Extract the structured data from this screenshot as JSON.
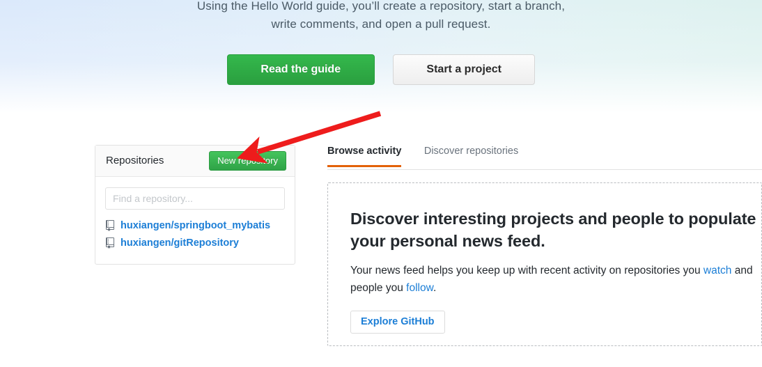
{
  "hero": {
    "line_1": "Using the Hello World guide, you’ll create a repository, start a branch,",
    "line_2": "write comments, and open a pull request.",
    "read_guide_label": "Read the guide",
    "start_project_label": "Start a project",
    "read_guide_color": "#2a9f3f",
    "background_left_color": "#dbe9fb",
    "background_right_color": "#ddf1ef"
  },
  "repositories": {
    "title": "Repositories",
    "new_repository_label": "New repository",
    "new_repository_color": "#2fa347",
    "search_placeholder": "Find a repository...",
    "search_value": "",
    "items": [
      {
        "name": "huxiangen/springboot_mybatis",
        "icon": "repo-icon"
      },
      {
        "name": "huxiangen/gitRepository",
        "icon": "repo-icon"
      }
    ]
  },
  "activity": {
    "tabs": [
      {
        "label": "Browse activity",
        "active": true
      },
      {
        "label": "Discover repositories",
        "active": false
      }
    ],
    "active_tab_underline_color": "#e36209",
    "callout": {
      "heading": "Discover interesting projects and people to populate your personal news feed.",
      "description_part_1": "Your news feed helps you keep up with recent activity on repositories you ",
      "description_link_1": "watch",
      "description_part_2": " and people you ",
      "description_link_2": "follow",
      "description_part_3": ".",
      "explore_label": "Explore GitHub",
      "link_color": "#1c7ed6"
    }
  },
  "annotation": {
    "arrow": "red-arrow",
    "color": "#ee1c1c",
    "points_to": "New repository"
  }
}
